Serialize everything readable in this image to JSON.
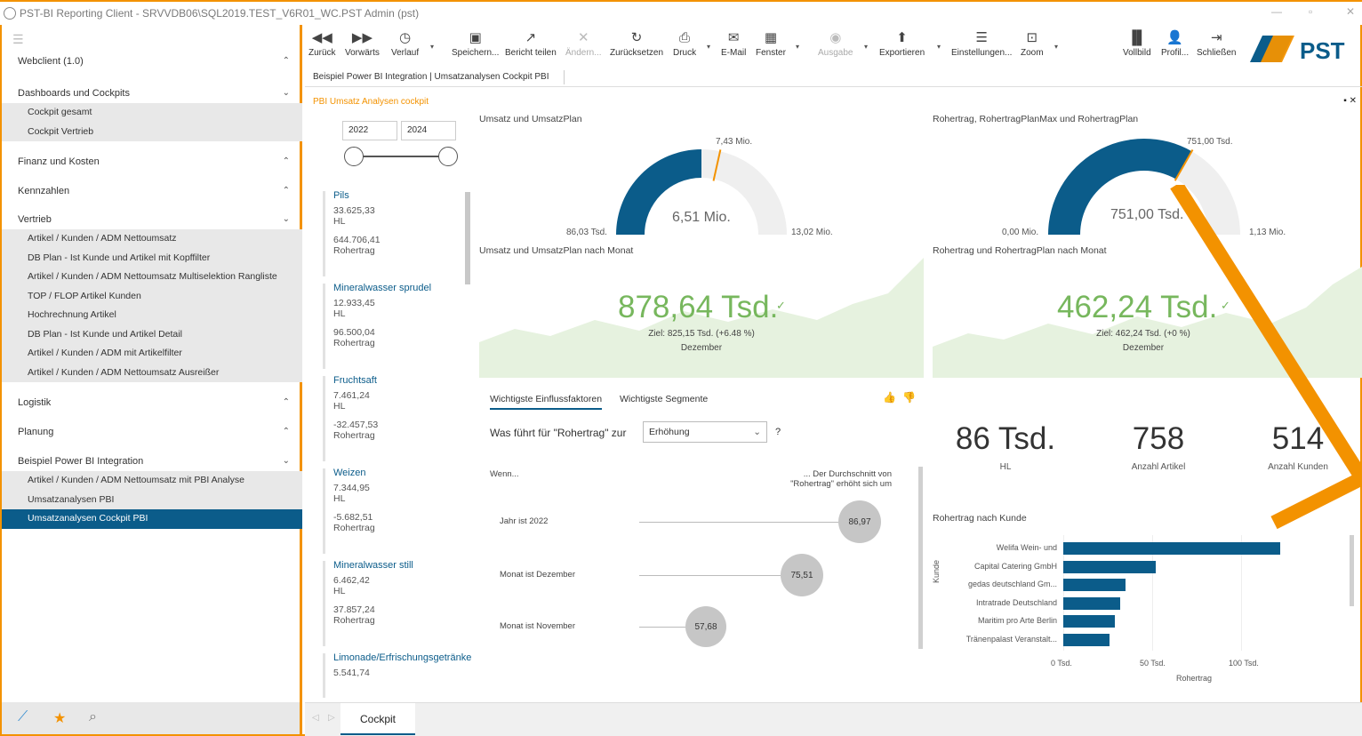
{
  "window": {
    "title": "PST-BI Reporting Client - SRVVDB06\\SQL2019.TEST_V6R01_WC.PST Admin (pst)",
    "minimize": "—",
    "restore": "▫",
    "close": "✕"
  },
  "sidebar": {
    "sections": [
      {
        "label": "Webclient (1.0)",
        "chevron": "up",
        "items": []
      },
      {
        "label": "Dashboards und Cockpits",
        "chevron": "down",
        "items": [
          "Cockpit gesamt",
          "Cockpit Vertrieb"
        ]
      },
      {
        "label": "Finanz und Kosten",
        "chevron": "up",
        "items": []
      },
      {
        "label": "Kennzahlen",
        "chevron": "up",
        "items": []
      },
      {
        "label": "Vertrieb",
        "chevron": "down",
        "items": [
          "Artikel / Kunden / ADM Nettoumsatz",
          "DB Plan - Ist  Kunde und Artikel mit Kopffilter",
          "Artikel / Kunden / ADM Nettoumsatz Multiselektion Rangliste",
          "TOP / FLOP Artikel Kunden",
          "Hochrechnung Artikel",
          "DB Plan - Ist  Kunde und Artikel Detail",
          "Artikel / Kunden / ADM mit Artikelfilter",
          "Artikel / Kunden / ADM Nettoumsatz Ausreißer"
        ]
      },
      {
        "label": "Logistik",
        "chevron": "up",
        "items": []
      },
      {
        "label": "Planung",
        "chevron": "up",
        "items": []
      },
      {
        "label": "Beispiel Power BI Integration",
        "chevron": "down",
        "items": [
          "Artikel / Kunden / ADM Nettoumsatz mit PBI Analyse",
          "Umsatzanalysen PBI",
          "Umsatzanalysen Cockpit PBI"
        ]
      }
    ],
    "active_item": "Umsatzanalysen Cockpit PBI"
  },
  "toolbar": {
    "back": "Zurück",
    "forward": "Vorwärts",
    "history": "Verlauf",
    "save": "Speichern...",
    "share": "Bericht teilen",
    "change": "Ändern...",
    "reset": "Zurücksetzen",
    "print": "Druck",
    "email": "E-Mail",
    "window": "Fenster",
    "output": "Ausgabe",
    "export": "Exportieren",
    "settings": "Einstellungen...",
    "zoom": "Zoom",
    "fullscreen": "Vollbild",
    "profile": "Profil...",
    "close": "Schließen",
    "logo_text": "PST"
  },
  "breadcrumb": "Beispiel Power BI Integration | Umsatzanalysen Cockpit PBI",
  "report": {
    "title": "PBI Umsatz Analysen cockpit",
    "pin": "▪ ✕",
    "year_from": "2022",
    "year_to": "2024",
    "products": [
      {
        "name": "Pils",
        "v1": "33.625,33",
        "u1": "HL",
        "v2": "644.706,41",
        "u2": "Rohertrag"
      },
      {
        "name": "Mineralwasser sprudel",
        "v1": "12.933,45",
        "u1": "HL",
        "v2": "96.500,04",
        "u2": "Rohertrag"
      },
      {
        "name": "Fruchtsaft",
        "v1": "7.461,24",
        "u1": "HL",
        "v2": "-32.457,53",
        "u2": "Rohertrag"
      },
      {
        "name": "Weizen",
        "v1": "7.344,95",
        "u1": "HL",
        "v2": "-5.682,51",
        "u2": "Rohertrag"
      },
      {
        "name": "Mineralwasser still",
        "v1": "6.462,42",
        "u1": "HL",
        "v2": "37.857,24",
        "u2": "Rohertrag"
      },
      {
        "name": "Limonade/Erfrischungsgetränke",
        "v1": "5.541,74",
        "u1": "",
        "v2": "",
        "u2": ""
      }
    ],
    "gauge1": {
      "title": "Umsatz und UmsatzPlan",
      "value": "6,51 Mio.",
      "target": "7,43 Mio.",
      "min": "86,03 Tsd.",
      "max": "13,02 Mio.",
      "fraction": 0.5,
      "target_fraction": 0.57
    },
    "gauge2": {
      "title": "Rohertrag, RohertragPlanMax und RohertragPlan",
      "value": "751,00 Tsd.",
      "target": "751,00 Tsd.",
      "min": "0,00 Mio.",
      "max": "1,13 Mio.",
      "fraction": 0.665,
      "target_fraction": 0.665
    },
    "kpi1": {
      "title": "Umsatz und UmsatzPlan nach Monat",
      "value": "878,64 Tsd.",
      "goal": "Ziel: 825,15 Tsd. (+6.48 %)",
      "period": "Dezember"
    },
    "kpi2": {
      "title": "Rohertrag und RohertragPlan nach Monat",
      "value": "462,24 Tsd.",
      "goal": "Ziel: 462,24 Tsd. (+0 %)",
      "period": "Dezember"
    },
    "influencers": {
      "tab1": "Wichtigste Einflussfaktoren",
      "tab2": "Wichtigste Segmente",
      "question_prefix": "Was führt für \"Rohertrag\" zur",
      "dropdown_value": "Erhöhung",
      "question_mark": "?",
      "col_when": "Wenn...",
      "col_avg_line1": "... Der Durchschnitt von",
      "col_avg_line2": "\"Rohertrag\" erhöht sich um",
      "rows": [
        {
          "label": "Jahr ist 2022",
          "value": "86,97"
        },
        {
          "label": "Monat ist Dezember",
          "value": "75,51"
        },
        {
          "label": "Monat ist November",
          "value": "57,68"
        }
      ]
    },
    "cards": [
      {
        "value": "86 Tsd.",
        "label": "HL"
      },
      {
        "value": "758",
        "label": "Anzahl Artikel"
      },
      {
        "value": "514",
        "label": "Anzahl Kunden"
      }
    ]
  },
  "chart_data": {
    "type": "bar",
    "title": "Rohertrag nach Kunde",
    "xlabel": "Rohertrag",
    "ylabel": "Kunde",
    "categories": [
      "Welifa Wein- und",
      "Capital Catering GmbH",
      "gedas deutschland Gm...",
      "Intratrade Deutschland",
      "Maritim pro Arte Berlin",
      "Tränenpalast Veranstalt..."
    ],
    "values": [
      122,
      52,
      35,
      32,
      29,
      26
    ],
    "xticks": [
      "0 Tsd.",
      "50 Tsd.",
      "100 Tsd."
    ],
    "xlim": [
      0,
      140
    ],
    "orientation": "horizontal"
  },
  "bottom_tab": "Cockpit",
  "colors": {
    "accent": "#f39200",
    "primary": "#0b5c8a",
    "positive": "#77b75d"
  }
}
